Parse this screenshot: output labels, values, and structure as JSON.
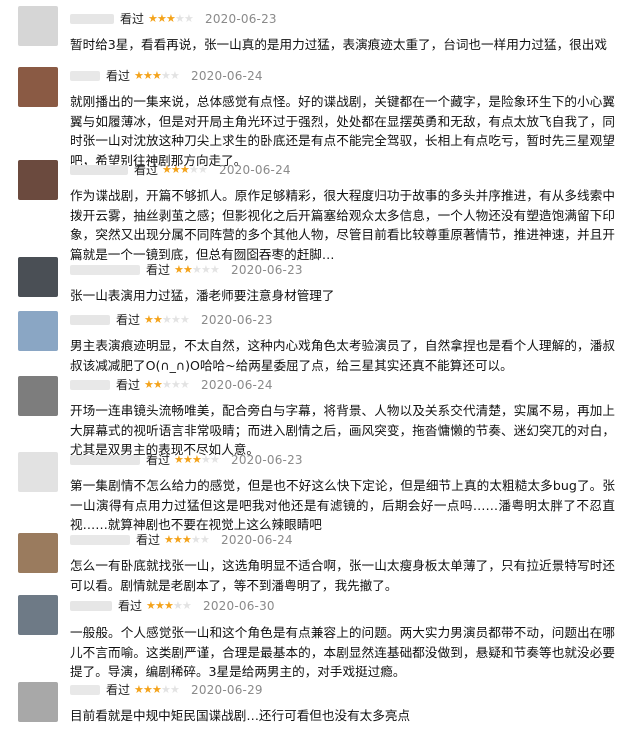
{
  "colors": {
    "star_on": "#f4a31b",
    "star_off": "#e3e3e3",
    "date": "#8a8a8a",
    "text": "#111111"
  },
  "icons": {
    "star": "star-icon"
  },
  "reviews": [
    {
      "status": "看过",
      "rating": 3,
      "date": "2020-06-23",
      "content": "暂时给3星，看看再说，张一山真的是用力过猛，表演痕迹太重了，台词也一样用力过猛，很出戏",
      "avatar_color": "#d6d6d6",
      "name_color": "#e6e6e6"
    },
    {
      "status": "看过",
      "rating": 3,
      "date": "2020-06-24",
      "content": "就刚播出的一集来说，总体感觉有点怪。好的谍战剧，关键都在一个藏字，是险象环生下的小心翼翼与如履薄冰，但是对开局主角光环过于强烈，处处都在显摆英勇和无敌，有点太放飞自我了，同时张一山对沈放这种刀尖上求生的卧底还是有点不能完全驾驭，长相上有点吃亏，暂时先三星观望吧，希望别往神剧那方向走了。",
      "avatar_color": "#8a5a44",
      "name_color": "#e8e8e8"
    },
    {
      "status": "看过",
      "rating": 3,
      "date": "2020-06-24",
      "content": "作为谍战剧，开篇不够抓人。原作足够精彩，很大程度归功于故事的多头并序推进，有从多线索中拨开云雾，抽丝剥茧之感；但影视化之后开篇塞给观众太多信息，一个人物还没有塑造饱满留下印象，突然又出现分属不同阵营的多个其他人物，尽管目前看比较尊重原著情节，推进神速，并且开篇就是一个一镜到底，但总有囫囵吞枣的赶脚…",
      "avatar_color": "#6b4a3e",
      "name_color": "#e6e6e6"
    },
    {
      "status": "看过",
      "rating": 2,
      "date": "2020-06-23",
      "content": "张一山表演用力过猛，潘老师要注意身材管理了",
      "avatar_color": "#4a4f55",
      "name_color": "#e8e8e8"
    },
    {
      "status": "看过",
      "rating": 2,
      "date": "2020-06-23",
      "content": "男主表演痕迹明显，不太自然，这种内心戏角色太考验演员了，自然拿捏也是看个人理解的，潘叔叔该减减肥了O(∩_∩)O哈哈~给两星委屈了点，给三星其实还真不能算还可以。",
      "avatar_color": "#8aa6c4",
      "name_color": "#e6e6e6"
    },
    {
      "status": "看过",
      "rating": 2,
      "date": "2020-06-24",
      "content": "开场一连串镜头流畅唯美，配合旁白与字幕，将背景、人物以及关系交代清楚，实属不易，再加上大屏幕式的视听语言非常吸睛；而进入剧情之后，画风突变，拖沓慵懒的节奏、迷幻突兀的对白，尤其是双男主的表现不尽如人意。",
      "avatar_color": "#7d7d7d",
      "name_color": "#e8e8e8"
    },
    {
      "status": "看过",
      "rating": 3,
      "date": "2020-06-23",
      "content": "第一集剧情不怎么给力的感觉，但是也不好这么快下定论，但是细节上真的太粗糙太多bug了。张一山演得有点用力过猛但这是吧我对他还是有滤镜的，后期会好一点吗……潘粤明太胖了不忍直视……就算神剧也不要在视觉上这么辣眼睛吧",
      "avatar_color": "#e2e2e2",
      "name_color": "#e6e6e6"
    },
    {
      "status": "看过",
      "rating": 3,
      "date": "2020-06-24",
      "content": "怎么一有卧底就找张一山，这选角明显不适合啊，张一山太瘦身板太单薄了，只有拉近景特写时还可以看。剧情就是老剧本了，等不到潘粤明了，我先撤了。",
      "avatar_color": "#9a7b5e",
      "name_color": "#e8e8e8"
    },
    {
      "status": "看过",
      "rating": 3,
      "date": "2020-06-30",
      "content": "一般般。个人感觉张一山和这个角色是有点兼容上的问题。两大实力男演员都带不动，问题出在哪儿不言而喻。这类剧严谨，合理是最基本的，本剧显然连基础都没做到，悬疑和节奏等也就没必要提了。导演，编剧稀碎。3星是给两男主的，对手戏挺过瘾。",
      "avatar_color": "#6e7a86",
      "name_color": "#e6e6e6"
    },
    {
      "status": "看过",
      "rating": 3,
      "date": "2020-06-29",
      "content": "目前看就是中规中矩民国谍战剧…还行可看但也没有太多亮点",
      "avatar_color": "#a8a8a8",
      "name_color": "#e8e8e8"
    }
  ]
}
